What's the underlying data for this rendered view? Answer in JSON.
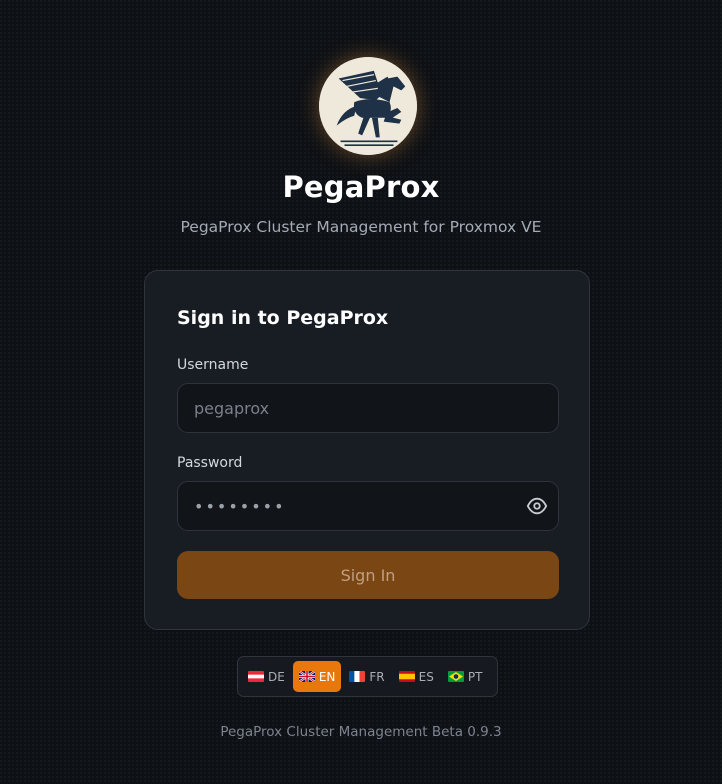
{
  "brand": {
    "title": "PegaProx",
    "subtitle": "PegaProx Cluster Management for Proxmox VE",
    "logo_icon": "pegasus-logo"
  },
  "login": {
    "heading": "Sign in to PegaProx",
    "username_label": "Username",
    "username_placeholder": "pegaprox",
    "password_label": "Password",
    "password_value": "••••••••",
    "show_password_icon": "eye-icon",
    "submit_label": "Sign In"
  },
  "languages": [
    {
      "code": "DE",
      "flag": "flag-at",
      "active": false
    },
    {
      "code": "EN",
      "flag": "flag-gb",
      "active": true
    },
    {
      "code": "FR",
      "flag": "flag-fr",
      "active": false
    },
    {
      "code": "ES",
      "flag": "flag-es",
      "active": false
    },
    {
      "code": "PT",
      "flag": "flag-br",
      "active": false
    }
  ],
  "footer": {
    "text": "PegaProx Cluster Management Beta 0.9.3"
  },
  "colors": {
    "accent": "#e8780c",
    "button": "#7a4614",
    "background": "#0d1014",
    "card": "#181c23"
  }
}
